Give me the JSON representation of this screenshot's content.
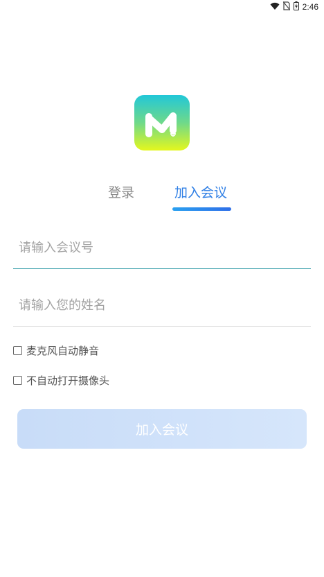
{
  "status_bar": {
    "time": "2:46",
    "icons": [
      "wifi-icon",
      "no-sim-icon",
      "battery-charging-icon"
    ]
  },
  "logo": {
    "icon": "app-logo-m-icon",
    "gradient": [
      "#21c7d8",
      "#e4f71d"
    ]
  },
  "tabs": [
    {
      "label": "登录",
      "active": false
    },
    {
      "label": "加入会议",
      "active": true
    }
  ],
  "form": {
    "meeting_id_placeholder": "请输入会议号",
    "meeting_id_value": "",
    "name_placeholder": "请输入您的姓名",
    "name_value": ""
  },
  "options": [
    {
      "label": "麦克风自动静音",
      "checked": false
    },
    {
      "label": "不自动打开摄像头",
      "checked": false
    }
  ],
  "join_button": {
    "label": "加入会议",
    "enabled": false
  },
  "colors": {
    "accent": "#2f7fe5",
    "focused_underline": "#2e9aa6",
    "button_disabled": "#cfe1fa"
  }
}
